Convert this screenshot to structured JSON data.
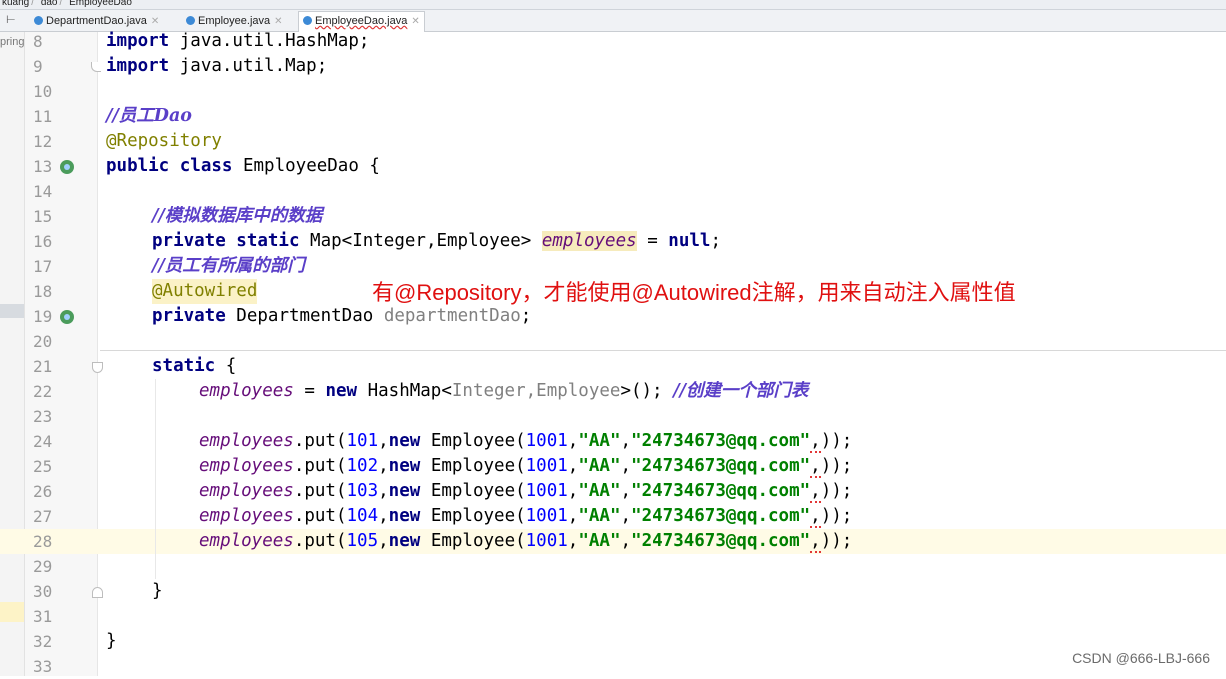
{
  "breadcrumbs": [
    "kuang",
    "dao",
    "EmployeeDao"
  ],
  "tabs": [
    {
      "label": "DepartmentDao.java",
      "active": false
    },
    {
      "label": "Employee.java",
      "active": false
    },
    {
      "label": "EmployeeDao.java",
      "active": true
    }
  ],
  "left_panel_stub": "pring",
  "line_numbers": [
    "8",
    "9",
    "10",
    "11",
    "12",
    "13",
    "14",
    "15",
    "16",
    "17",
    "18",
    "19",
    "20",
    "21",
    "22",
    "23",
    "24",
    "25",
    "26",
    "27",
    "28",
    "29",
    "30",
    "31",
    "32",
    "33"
  ],
  "code": {
    "l8": [
      "import",
      " java.util.HashMap;"
    ],
    "l9": [
      "import",
      " java.util.Map;"
    ],
    "l11": "//员工Dao",
    "l12": "@Repository",
    "l13": [
      "public class",
      " EmployeeDao {"
    ],
    "l15": "//模拟数据库中的数据",
    "l16": [
      "private static",
      " Map<Integer,Employee> ",
      "employees",
      " = ",
      "null",
      ";"
    ],
    "l17": "//员工有所属的部门",
    "l18": "@Autowired",
    "l19": [
      "private",
      " DepartmentDao ",
      "departmentDao",
      ";"
    ],
    "l21": [
      "static",
      " {"
    ],
    "l22": [
      "employees",
      " = ",
      "new",
      " HashMap<",
      "Integer,Employee",
      ">(); ",
      "//创建一个部门表"
    ],
    "put_rows": [
      {
        "key": "101",
        "id": "1001",
        "name": "\"AA\"",
        "email": "\"24734673@qq.com\""
      },
      {
        "key": "102",
        "id": "1001",
        "name": "\"AA\"",
        "email": "\"24734673@qq.com\""
      },
      {
        "key": "103",
        "id": "1001",
        "name": "\"AA\"",
        "email": "\"24734673@qq.com\""
      },
      {
        "key": "104",
        "id": "1001",
        "name": "\"AA\"",
        "email": "\"24734673@qq.com\""
      },
      {
        "key": "105",
        "id": "1001",
        "name": "\"AA\"",
        "email": "\"24734673@qq.com\""
      }
    ],
    "put_parts": {
      "field": "employees",
      "call": ".put(",
      "comma": ",",
      "new": "new",
      "ctor": " Employee(",
      "tail_err": ",",
      "close": "));"
    },
    "l30": "}",
    "l32": "}"
  },
  "annotation_note": "有@Repository，才能使用@Autowired注解，用来自动注入属性值",
  "watermark": "CSDN @666-LBJ-666"
}
